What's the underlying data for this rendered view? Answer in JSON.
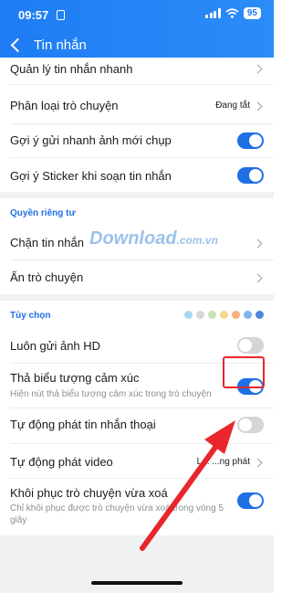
{
  "status_bar": {
    "time": "09:57",
    "battery": "95"
  },
  "header": {
    "title": "Tin nhắn"
  },
  "rows": {
    "quick_manage": "Quản lý tin nhắn nhanh",
    "classify": "Phân loại trò chuyện",
    "classify_value": "Đang tắt",
    "suggest_photo": "Gợi ý gửi nhanh ảnh mới chụp",
    "suggest_sticker": "Gợi ý Sticker khi soạn tin nhắn",
    "block": "Chặn tin nhắn",
    "hide": "Ẩn trò chuyện",
    "hd": "Luôn gửi ảnh HD",
    "reaction": "Thả biểu tượng cảm xúc",
    "reaction_sub": "Hiện nút thả biểu tượng cảm xúc trong trò chuyện",
    "voice_autoplay": "Tự động phát tin nhắn thoại",
    "video_autoplay": "Tự động phát video",
    "video_value": "L... ...ng phát",
    "restore": "Khôi phục trò chuyện vừa xoá",
    "restore_sub": "Chỉ khôi phục được trò chuyện vừa xoá trong vòng 5 giây"
  },
  "sections": {
    "privacy": "Quyền riêng tư",
    "options": "Tùy chọn"
  },
  "toggles": {
    "suggest_photo": true,
    "suggest_sticker": true,
    "hd": false,
    "reaction": true,
    "voice_autoplay": false,
    "restore": true
  },
  "theme_dots": [
    "#a8d8f0",
    "#d7d7d7",
    "#c9e3b5",
    "#f4d58a",
    "#f7b27c",
    "#7fb3ec",
    "#4f86db"
  ],
  "watermark": {
    "main": "Download",
    "suffix": ".com.vn"
  }
}
